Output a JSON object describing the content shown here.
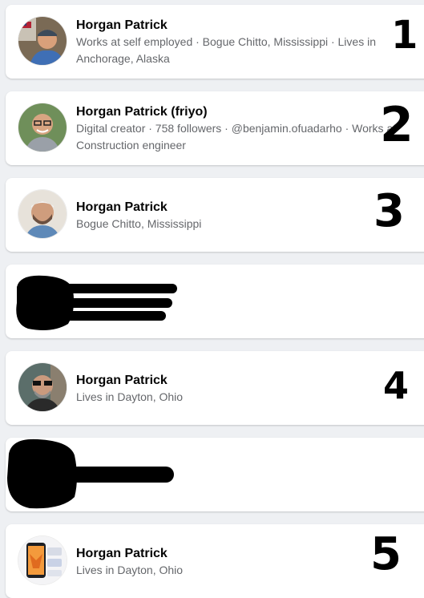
{
  "results": [
    {
      "name": "Horgan Patrick",
      "meta": "Works at self employed · Bogue Chitto, Mississippi · Lives in Anchorage, Alaska",
      "annotation": "1"
    },
    {
      "name": "Horgan Patrick (friyo)",
      "meta": "Digital creator · 758 followers · @benjamin.ofuadarho · Works at Construction engineer",
      "annotation": "2"
    },
    {
      "name": "Horgan Patrick",
      "meta": "Bogue Chitto, Mississippi",
      "annotation": "3"
    },
    {
      "name": "Horgan Patrick",
      "meta": "Lives in Dayton, Ohio",
      "annotation": "4"
    },
    {
      "name": "Horgan Patrick",
      "meta": "Lives in Dayton, Ohio",
      "annotation": "5"
    }
  ],
  "colors": {
    "page_background": "#eef0f3",
    "card_background": "#ffffff",
    "name_text": "#050505",
    "meta_text": "#65676b",
    "annotation_ink": "#000000"
  }
}
